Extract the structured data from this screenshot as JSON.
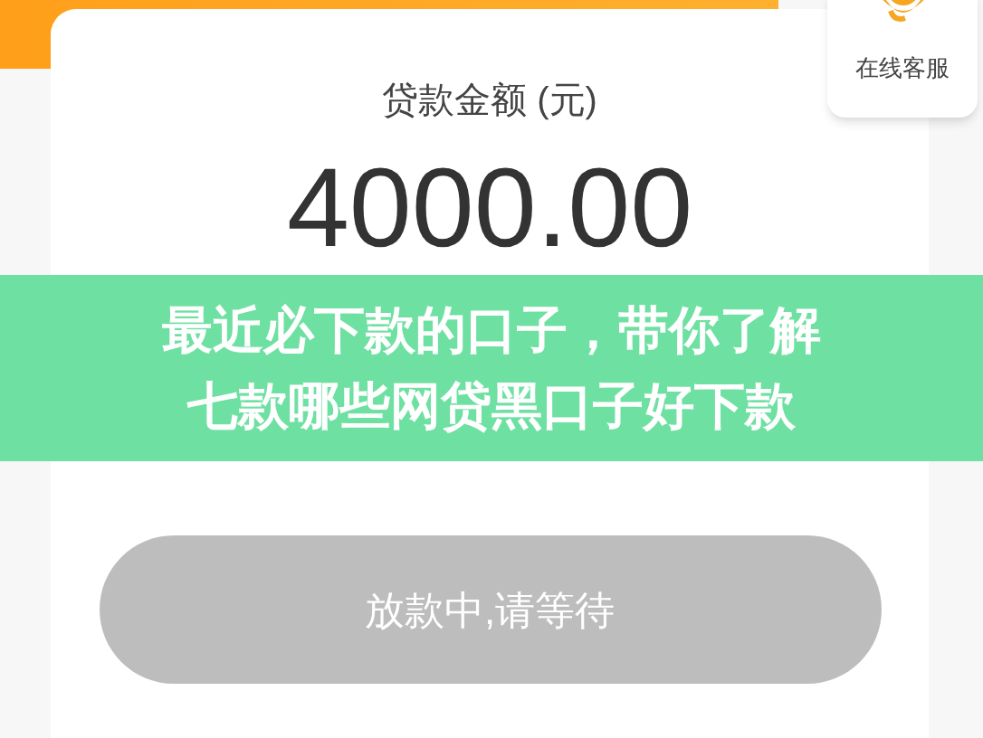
{
  "support_button": {
    "label": "在线客服"
  },
  "loan_card": {
    "label": "贷款金额 (元)",
    "amount": "4000.00"
  },
  "banner": {
    "lines": [
      "最近必下款的口子，带你了解",
      "七款哪些网贷黑口子好下款"
    ]
  },
  "status_button": {
    "label": "放款中,请等待",
    "disabled": true
  }
}
